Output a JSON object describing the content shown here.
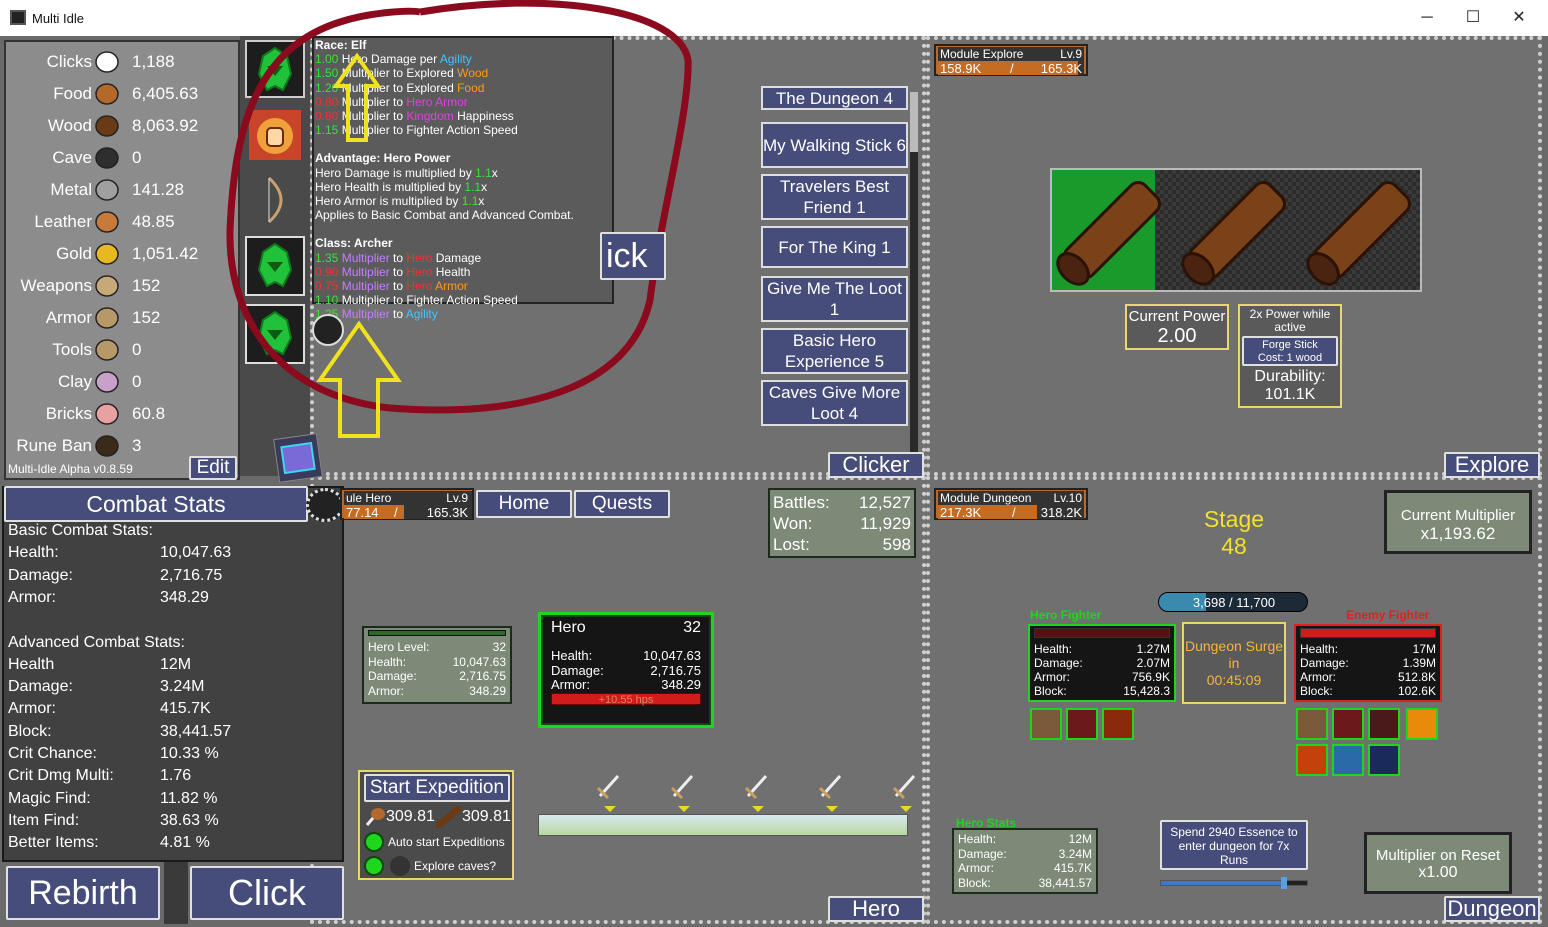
{
  "window": {
    "title": "Multi Idle",
    "minimize": "─",
    "maximize": "☐",
    "close": "✕"
  },
  "resources": [
    {
      "label": "Clicks",
      "value": "1,188",
      "icon": "pointer-hand-icon"
    },
    {
      "label": "Food",
      "value": "6,405.63",
      "icon": "drumstick-icon"
    },
    {
      "label": "Wood",
      "value": "8,063.92",
      "icon": "log-icon"
    },
    {
      "label": "Cave",
      "value": "0",
      "icon": "rock-icon"
    },
    {
      "label": "Metal",
      "value": "141.28",
      "icon": "metal-bar-icon"
    },
    {
      "label": "Leather",
      "value": "48.85",
      "icon": "hide-icon"
    },
    {
      "label": "Gold",
      "value": "1,051.42",
      "icon": "gold-coins-icon"
    },
    {
      "label": "Weapons",
      "value": "152",
      "icon": "sword-icon"
    },
    {
      "label": "Armor",
      "value": "152",
      "icon": "chestplate-icon"
    },
    {
      "label": "Tools",
      "value": "0",
      "icon": "hammer-icon"
    },
    {
      "label": "Clay",
      "value": "0",
      "icon": "clay-icon"
    },
    {
      "label": "Bricks",
      "value": "60.8",
      "icon": "brick-icon"
    },
    {
      "label": "Rune Ban",
      "value": "3",
      "icon": "rune-icon"
    }
  ],
  "version": "Multi-Idle Alpha v0.8.59",
  "edit_label": "Edit",
  "combat": {
    "title": "Combat Stats",
    "basic_title": "Basic Combat Stats:",
    "basic": [
      {
        "k": "Health:",
        "v": "10,047.63"
      },
      {
        "k": "Damage:",
        "v": "2,716.75"
      },
      {
        "k": "Armor:",
        "v": "348.29"
      }
    ],
    "adv_title": "Advanced Combat Stats:",
    "advanced": [
      {
        "k": "Health",
        "v": "12M"
      },
      {
        "k": "Damage:",
        "v": "3.24M"
      },
      {
        "k": "Armor:",
        "v": "415.7K"
      },
      {
        "k": "Block:",
        "v": "38,441.57"
      },
      {
        "k": "Crit Chance:",
        "v": "10.33 %"
      },
      {
        "k": "Crit Dmg Multi:",
        "v": "1.76"
      },
      {
        "k": "Magic Find:",
        "v": "11.82 %"
      },
      {
        "k": "Item Find:",
        "v": "38.63 %"
      },
      {
        "k": "Better Items:",
        "v": "4.81 %"
      }
    ]
  },
  "rebirth_label": "Rebirth",
  "click_label": "Click",
  "tooltip": {
    "race_title": "Race: Elf",
    "race_lines": [
      [
        "1.00",
        " Hero Damage per ",
        "Agility"
      ],
      [
        "1.50",
        " Multiplier to Explored ",
        "Wood"
      ],
      [
        "1.20",
        " Multiplier to Explored ",
        "Food"
      ],
      [
        "0.80",
        " Multiplier to ",
        "Hero Armor"
      ],
      [
        "0.80",
        " Multiplier to ",
        "Kingdom",
        " Happiness"
      ],
      [
        "1.15",
        " Multiplier to Fighter Action Speed"
      ]
    ],
    "adv_title": "Advantage: Hero Power",
    "adv_lines": [
      [
        "Hero Damage is multiplied by ",
        "1.1",
        "x"
      ],
      [
        "Hero Health is multiplied by ",
        "1.1",
        "x"
      ],
      [
        "Hero Armor is multiplied by ",
        "1.1",
        "x"
      ],
      [
        "Applies to Basic Combat and Advanced Combat."
      ]
    ],
    "class_title": "Class: Archer",
    "class_lines": [
      [
        "1.35",
        " Multiplier",
        " to ",
        "Hero",
        " Damage"
      ],
      [
        "0.90",
        " Multiplier",
        " to ",
        "Hero",
        " Health"
      ],
      [
        "0.75",
        " Multiplier",
        " to ",
        "Hero",
        " Armor"
      ],
      [
        "1.10",
        " Multiplier to Fighter Action Speed"
      ],
      [
        "1.25",
        " Multiplier",
        " to ",
        "Agility"
      ]
    ]
  },
  "quests": [
    "The Dungeon 4",
    "My Walking Stick 6",
    "Travelers Best Friend 1",
    "For The King 1",
    "Give Me The Loot 1",
    "Basic Hero Experience 5",
    "Caves Give More Loot 4"
  ],
  "clicker_tab": "Clicker",
  "click_partial": "ick",
  "explore": {
    "module": "Module Explore",
    "level": "Lv.9",
    "xp": "158.9K",
    "slash": "/",
    "xp_max": "165.3K",
    "xp_fraction": 0.96,
    "current_power_label": "Current Power",
    "current_power": "2.00",
    "power_active": "2x Power while active",
    "forge_label": "Forge Stick",
    "forge_cost": "Cost: 1 wood",
    "durability_label": "Durability:",
    "durability": "101.1K",
    "tab": "Explore",
    "progress_fraction": 0.28
  },
  "hero": {
    "module": "ule Hero",
    "level": "Lv.9",
    "xp": "77.14",
    "slash": "/",
    "xp_max": "165.3K",
    "xp_fraction": 0.47,
    "home": "Home",
    "quests": "Quests",
    "battles_label": "Battles:",
    "battles": "12,527",
    "won_label": "Won:",
    "won": "11,929",
    "lost_label": "Lost:",
    "lost": "598",
    "level_label": "Hero Level:",
    "hero_level": "32",
    "health_label": "Health:",
    "health": "10,047.63",
    "damage_label": "Damage:",
    "damage": "2,716.75",
    "armor_label": "Armor:",
    "armor": "348.29",
    "card_name": "Hero",
    "card_level": "32",
    "regen": "+10.55 hps",
    "start_expedition": "Start Expedition",
    "exp_food": "309.81",
    "exp_wood": "309.81",
    "auto_start": "Auto start Expeditions",
    "explore_caves": "Explore caves?",
    "tab": "Hero"
  },
  "dungeon": {
    "module": "Module Dungeon",
    "level": "Lv.10",
    "xp": "217.3K",
    "slash": "/",
    "xp_max": "318.2K",
    "xp_fraction": 0.68,
    "stage_label": "Stage",
    "stage": "48",
    "current_multiplier_label": "Current Multiplier",
    "current_multiplier": "x1,193.62",
    "progress": "3,698 / 11,700",
    "progress_fraction": 0.316,
    "hero_fighter": "Hero Fighter",
    "enemy_fighter": "Enemy Fighter",
    "hero_stats": {
      "health": "1.27M",
      "damage": "2.07M",
      "armor": "756.9K",
      "block": "15,428.3"
    },
    "enemy_stats": {
      "health": "17M",
      "damage": "1.39M",
      "armor": "512.8K",
      "block": "102.6K"
    },
    "health_label": "Health:",
    "damage_label": "Damage:",
    "armor_label": "Armor:",
    "block_label": "Block:",
    "surge_title": "Dungeon Surge in",
    "surge_time": "00:45:09",
    "hero_stats_title": "Hero Stats",
    "summary": {
      "health": "12M",
      "damage": "3.24M",
      "armor": "415.7K",
      "block": "38,441.57"
    },
    "spend_essence": "Spend 2940 Essence to enter dungeon for 7x Runs",
    "slider_fraction": 0.84,
    "reset_label": "Multiplier on Reset",
    "reset_value": "x1.00",
    "tab": "Dungeon"
  },
  "colors": {
    "accent": "#474d7a",
    "green_text": "#3ce03c",
    "stage_yellow": "#f2e22a",
    "annotation_red": "#8b0a1e",
    "annotation_yellow": "#f0e21c"
  }
}
